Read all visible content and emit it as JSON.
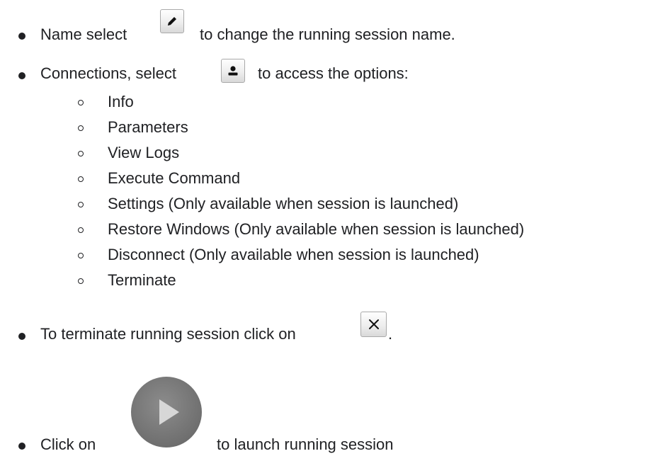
{
  "items": [
    {
      "before": "Name select",
      "icon": "pencil-icon",
      "after": "to change the running session name."
    },
    {
      "before": "Connections, select",
      "icon": "user-icon",
      "after": "to access the options:",
      "options": [
        "Info",
        "Parameters",
        "View Logs",
        "Execute Command",
        "Settings (Only available when session is launched)",
        "Restore Windows (Only available when session is launched)",
        "Disconnect (Only available when session is launched)",
        "Terminate"
      ]
    },
    {
      "before": "To terminate running session click on",
      "icon": "close-icon",
      "after": "."
    },
    {
      "before": "Click on",
      "icon": "play-icon",
      "after": "to launch running session"
    }
  ]
}
